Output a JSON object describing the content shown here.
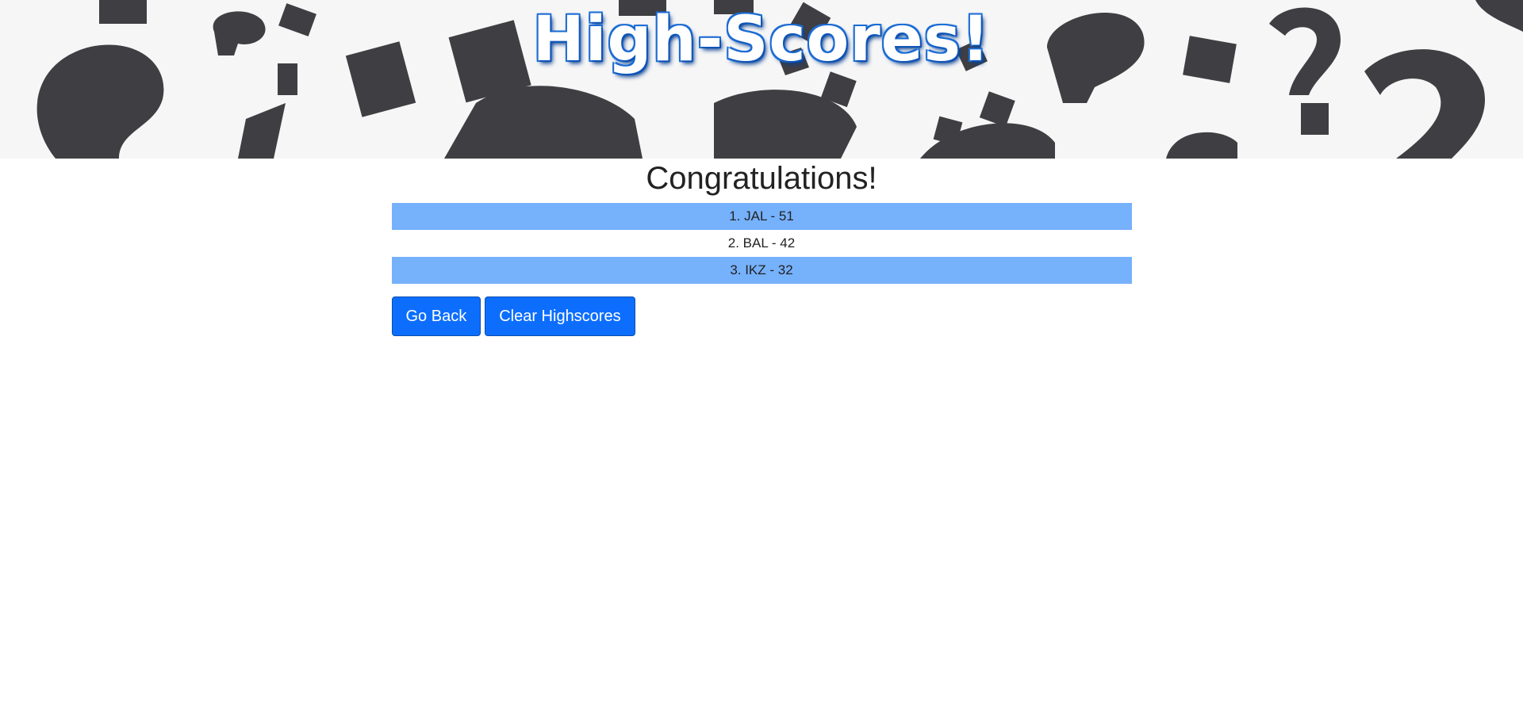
{
  "banner": {
    "title": "High-Scores!"
  },
  "main": {
    "heading": "Congratulations!",
    "scores": [
      "1. JAL - 51",
      "2. BAL - 42",
      "3. IKZ - 32"
    ]
  },
  "actions": {
    "go_back_label": "Go Back",
    "clear_label": "Clear Highscores"
  },
  "colors": {
    "highlight_row": "#76b1fc",
    "button": "#0d6efd",
    "title_outline": "#1463c8"
  },
  "icons": {
    "banner_background": "question-mark-pattern"
  }
}
